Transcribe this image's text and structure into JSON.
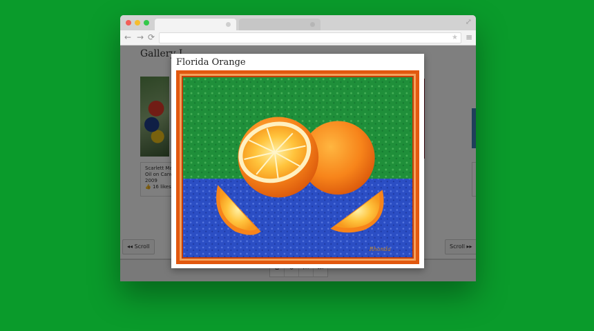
{
  "colors": {
    "background": "#0a9b2b",
    "frame": "#e2580f",
    "table": "#2b4ec4",
    "wall": "#1f8f3a",
    "orange": "#f7931e"
  },
  "browser": {
    "window_buttons": [
      "close",
      "minimize",
      "zoom"
    ],
    "tabs": [
      {
        "label": "",
        "active": true
      },
      {
        "label": "",
        "active": false
      }
    ],
    "nav": {
      "back_icon": "←",
      "forward_icon": "→",
      "reload_icon": "⟳",
      "star_icon": "★",
      "menu_icon": "≡",
      "expand_icon": "⤢"
    },
    "address": ""
  },
  "page": {
    "gallery_title": "Gallery",
    "gallery_suffix": "I",
    "caption": {
      "title": "Scarlett Mac",
      "medium": "Oil on Canva",
      "year": "2009",
      "likes": "16 likes",
      "likes_icon": "thumbs-up-icon"
    },
    "scroll_left": "◂◂ Scroll",
    "scroll_right": "Scroll ▸▸",
    "footer_icons": [
      "home-icon",
      "refresh-icon",
      "first-icon",
      "last-icon"
    ],
    "footer_glyphs": [
      "⌂",
      "↻",
      "⏮",
      "⏭"
    ]
  },
  "modal": {
    "title": "Florida Orange",
    "painting": {
      "subject": "oranges on a blue table",
      "signature": "Rhonda"
    }
  }
}
